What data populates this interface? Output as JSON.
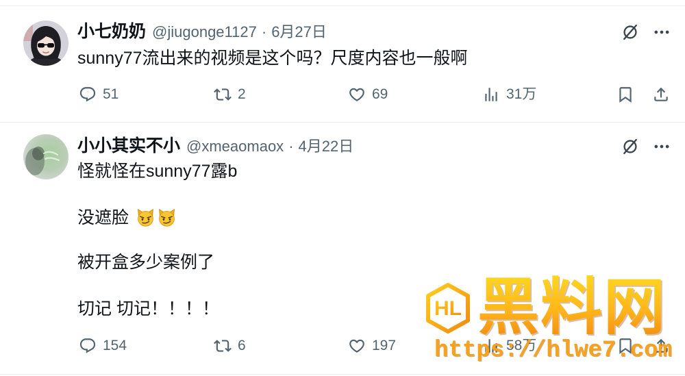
{
  "colors": {
    "text_primary": "#0f1419",
    "text_secondary": "#536471",
    "divider": "#e7ebed",
    "watermark_orange": "#f6a21c",
    "watermark_yellow": "#ffd71f",
    "emoji_yellow": "#f8c631"
  },
  "icons": {
    "reply": "reply-icon",
    "retweet": "retweet-icon",
    "like": "heart-icon",
    "views": "views-chart-icon",
    "bookmark": "bookmark-icon",
    "share": "share-icon",
    "grok": "grok-icon",
    "more": "more-dots-icon"
  },
  "tweets": [
    {
      "author": {
        "display_name": "小七奶奶",
        "handle": "@jiugonge1127",
        "avatar": "avatar-icon"
      },
      "separator": "·",
      "date": "6月27日",
      "body": [
        {
          "text": "sunny77流出来的视频是这个吗？尺度内容也一般啊"
        }
      ],
      "actions": {
        "reply_count": "51",
        "retweet_count": "2",
        "like_count": "69",
        "view_count": "31万"
      }
    },
    {
      "author": {
        "display_name": "小小其实不小",
        "handle": "@xmeaomaox",
        "avatar": "avatar-icon"
      },
      "separator": "·",
      "date": "4月22日",
      "body": [
        {
          "text": "怪就怪在sunny77露b"
        },
        {
          "text": "没遮脸",
          "emoji": [
            "smirking-cat-icon",
            "smirking-cat-icon"
          ]
        },
        {
          "text": "被开盒多少案例了"
        },
        {
          "text": "切记 切记！！！！"
        }
      ],
      "actions": {
        "reply_count": "154",
        "retweet_count": "6",
        "like_count": "197",
        "view_count": "58万"
      }
    }
  ],
  "watermark": {
    "logo_text": "HL",
    "brand": "黑料网",
    "url": "https://hlwe7.com"
  }
}
